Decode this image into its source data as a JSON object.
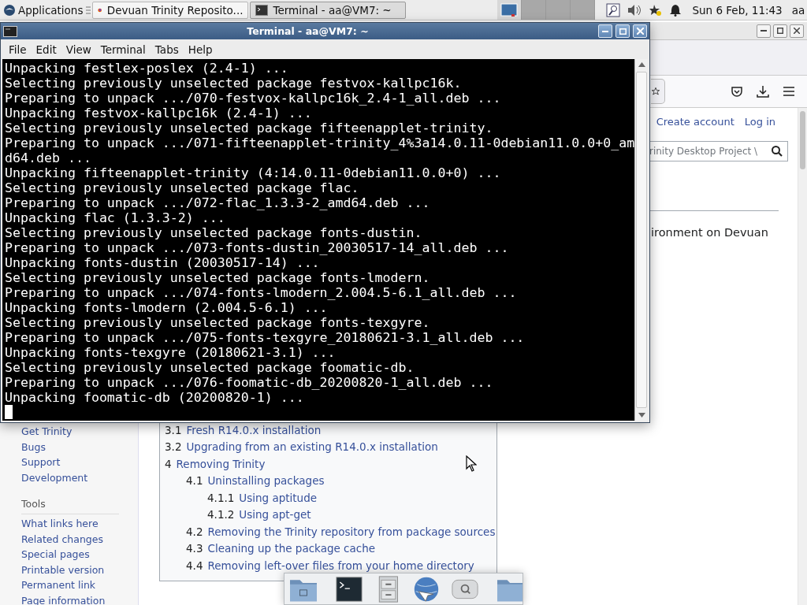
{
  "panel": {
    "menu_label": "Applications",
    "tasks": [
      {
        "title": "Devuan Trinity Reposito...",
        "kind": "browser",
        "selected": false
      },
      {
        "title": "Terminal - aa@VM7: ~",
        "kind": "terminal",
        "selected": true
      }
    ],
    "clock": "Sun  6 Feb, 11:43",
    "user": "aa"
  },
  "terminal": {
    "title": "Terminal - aa@VM7: ~",
    "menu": [
      "File",
      "Edit",
      "View",
      "Terminal",
      "Tabs",
      "Help"
    ],
    "lines": [
      "Unpacking festlex-poslex (2.4-1) ...",
      "Selecting previously unselected package festvox-kallpc16k.",
      "Preparing to unpack .../070-festvox-kallpc16k_2.4-1_all.deb ...",
      "Unpacking festvox-kallpc16k (2.4-1) ...",
      "Selecting previously unselected package fifteenapplet-trinity.",
      "Preparing to unpack .../071-fifteenapplet-trinity_4%3a14.0.11-0debian11.0.0+0_am",
      "d64.deb ...",
      "Unpacking fifteenapplet-trinity (4:14.0.11-0debian11.0.0+0) ...",
      "Selecting previously unselected package flac.",
      "Preparing to unpack .../072-flac_1.3.3-2_amd64.deb ...",
      "Unpacking flac (1.3.3-2) ...",
      "Selecting previously unselected package fonts-dustin.",
      "Preparing to unpack .../073-fonts-dustin_20030517-14_all.deb ...",
      "Unpacking fonts-dustin (20030517-14) ...",
      "Selecting previously unselected package fonts-lmodern.",
      "Preparing to unpack .../074-fonts-lmodern_2.004.5-6.1_all.deb ...",
      "Unpacking fonts-lmodern (2.004.5-6.1) ...",
      "Selecting previously unselected package fonts-texgyre.",
      "Preparing to unpack .../075-fonts-texgyre_20180621-3.1_all.deb ...",
      "Unpacking fonts-texgyre (20180621-3.1) ...",
      "Selecting previously unselected package foomatic-db.",
      "Preparing to unpack .../076-foomatic-db_20200820-1_all.deb ...",
      "Unpacking foomatic-db (20200820-1) ..."
    ]
  },
  "browser": {
    "account_links": [
      "Create account",
      "Log in"
    ],
    "search": {
      "placeholder": "rinity Desktop Project \\"
    },
    "article_text": "ironment on Devuan",
    "sidebar": {
      "links": [
        "Get Trinity",
        "Bugs",
        "Support",
        "Development"
      ],
      "tools_heading": "Tools",
      "tools": [
        "What links here",
        "Related changes",
        "Special pages",
        "Printable version",
        "Permanent link",
        "Page information"
      ]
    },
    "toc": [
      {
        "number": "3.1",
        "title": "Fresh R14.0.x installation"
      },
      {
        "number": "3.2",
        "title": "Upgrading from an existing R14.0.x installation"
      },
      {
        "number": "4",
        "title": "Removing Trinity",
        "children": [
          {
            "number": "4.1",
            "title": "Uninstalling packages",
            "children": [
              {
                "number": "4.1.1",
                "title": "Using aptitude"
              },
              {
                "number": "4.1.2",
                "title": "Using apt-get"
              }
            ]
          },
          {
            "number": "4.2",
            "title": "Removing the Trinity repository from package sources"
          },
          {
            "number": "4.3",
            "title": "Cleaning up the package cache"
          },
          {
            "number": "4.4",
            "title": "Removing left-over files from your home directory"
          }
        ]
      }
    ]
  }
}
